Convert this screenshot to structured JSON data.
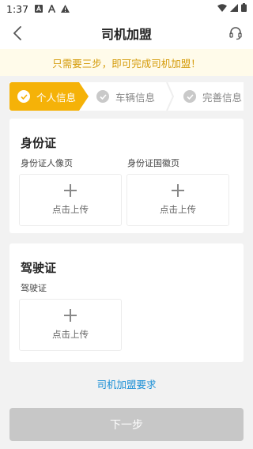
{
  "status_bar": {
    "time": "1:37",
    "icons_left": [
      "font-download-icon",
      "a-icon",
      "warning-icon"
    ],
    "icons_right": [
      "wifi-icon",
      "signal-icon",
      "battery-icon"
    ]
  },
  "nav": {
    "title": "司机加盟",
    "back_icon": "chevron-left-icon",
    "service_icon": "headset-icon"
  },
  "notice": {
    "text": "只需要三步，即可完成司机加盟！"
  },
  "steps": [
    {
      "label": "个人信息",
      "state": "active"
    },
    {
      "label": "车辆信息",
      "state": "inactive"
    },
    {
      "label": "完善信息",
      "state": "inactive"
    }
  ],
  "id_card": {
    "title": "身份证",
    "front_label": "身份证人像页",
    "back_label": "身份证国徽页",
    "upload_text": "点击上传"
  },
  "driver_license": {
    "title": "驾驶证",
    "label": "驾驶证",
    "upload_text": "点击上传"
  },
  "requirements_link": "司机加盟要求",
  "next_button": "下一步",
  "colors": {
    "accent": "#f5b208",
    "notice_text": "#d49a08",
    "link": "#1a8fd6",
    "disabled_button": "#c7c7c7"
  }
}
